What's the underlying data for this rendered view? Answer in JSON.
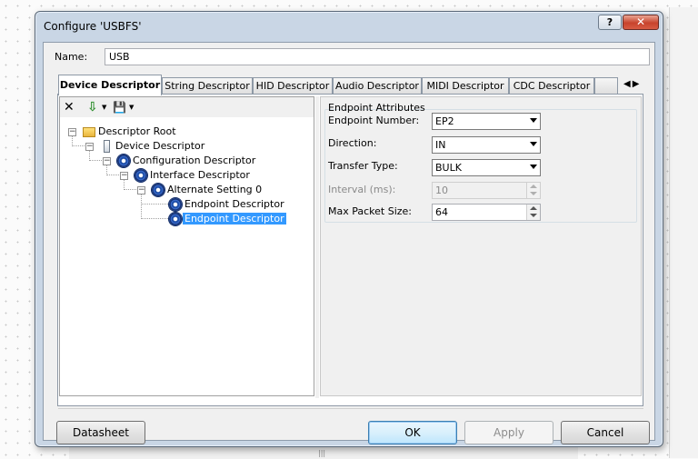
{
  "window": {
    "title": "Configure 'USBFS'",
    "help_label": "?",
    "close_label": "✕"
  },
  "name_field": {
    "label": "Name:",
    "value": "USB"
  },
  "tabs": [
    {
      "label": "Device Descriptor",
      "active": true
    },
    {
      "label": "String Descriptor"
    },
    {
      "label": "HID Descriptor"
    },
    {
      "label": "Audio Descriptor"
    },
    {
      "label": "MIDI Descriptor"
    },
    {
      "label": "CDC Descriptor"
    }
  ],
  "tab_scroll": {
    "left": "◀",
    "right": "▶"
  },
  "toolbar": {
    "delete_icon": "✕",
    "import_icon": "⇩",
    "save_icon": "💾",
    "dropdown_arrow": "▼"
  },
  "tree": [
    {
      "label": "Descriptor Root",
      "icon": "folder-icon",
      "depth": 0
    },
    {
      "label": "Device Descriptor",
      "icon": "device-icon",
      "depth": 1
    },
    {
      "label": "Configuration Descriptor",
      "icon": "gear-icon",
      "depth": 2
    },
    {
      "label": "Interface Descriptor",
      "icon": "gear-icon",
      "depth": 3
    },
    {
      "label": "Alternate Setting 0",
      "icon": "gear-icon",
      "depth": 4
    },
    {
      "label": "Endpoint Descriptor",
      "icon": "gear-icon",
      "depth": 5
    },
    {
      "label": "Endpoint Descriptor",
      "icon": "gear-icon",
      "depth": 5,
      "selected": true
    }
  ],
  "expander_symbol": "−",
  "properties": {
    "group_title": "Endpoint Attributes",
    "endpoint_number": {
      "label": "Endpoint Number:",
      "value": "EP2"
    },
    "direction": {
      "label": "Direction:",
      "value": "IN"
    },
    "transfer_type": {
      "label": "Transfer Type:",
      "value": "BULK"
    },
    "interval": {
      "label": "Interval (ms):",
      "value": "10"
    },
    "max_packet_size": {
      "label": "Max Packet Size:",
      "value": "64"
    }
  },
  "buttons": {
    "datasheet": "Datasheet",
    "ok": "OK",
    "apply": "Apply",
    "cancel": "Cancel"
  },
  "background": {
    "grip": "|||"
  }
}
